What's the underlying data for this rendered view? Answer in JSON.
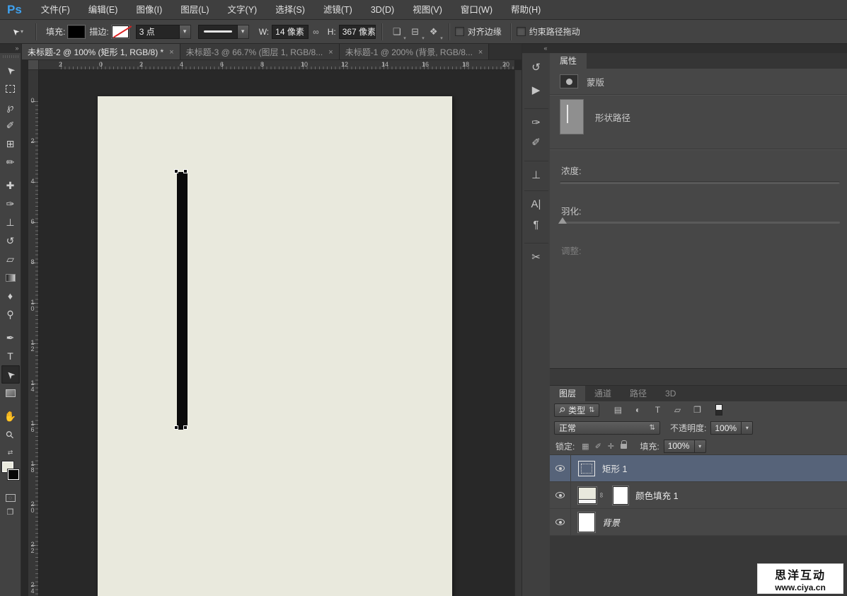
{
  "app": {
    "logo": "Ps",
    "brand_color": "#3fa2f0"
  },
  "menubar": {
    "items": [
      {
        "label": "文件(F)"
      },
      {
        "label": "编辑(E)"
      },
      {
        "label": "图像(I)"
      },
      {
        "label": "图层(L)"
      },
      {
        "label": "文字(Y)"
      },
      {
        "label": "选择(S)"
      },
      {
        "label": "滤镜(T)"
      },
      {
        "label": "3D(D)"
      },
      {
        "label": "视图(V)"
      },
      {
        "label": "窗口(W)"
      },
      {
        "label": "帮助(H)"
      }
    ]
  },
  "options_bar": {
    "tool_cursor_glyph": "➤",
    "dropdown_glyph": "▾",
    "fill_label": "填充:",
    "stroke_label": "描边:",
    "stroke_width_value": "3 点",
    "w_label": "W:",
    "w_value": "14 像素",
    "link_glyph": "∞",
    "h_label": "H:",
    "h_value": "367 像素",
    "path_ops_glyph": "❏",
    "path_align_glyph": "⊟",
    "path_arrange_glyph": "❖",
    "align_edges_label": "对齐边缘",
    "constrain_path_label": "约束路径拖动"
  },
  "tabs": [
    {
      "title": "未标题-2 @ 100% (矩形 1, RGB/8) *",
      "close": "×",
      "active": true
    },
    {
      "title": "未标题-3 @ 66.7% (图层 1, RGB/8...",
      "close": "×"
    },
    {
      "title": "未标题-1 @ 200% (背景, RGB/8...",
      "close": "×"
    }
  ],
  "toolbar": {
    "collapse_glyph": "»",
    "tools": [
      {
        "name": "move-tool",
        "glyph": "➤",
        "cls": "rot-cursor"
      },
      {
        "name": "rectangular-marquee-tool",
        "glyph": "",
        "box": "box-dashed"
      },
      {
        "name": "lasso-tool",
        "glyph": "℘"
      },
      {
        "name": "quick-selection-tool",
        "glyph": "✐"
      },
      {
        "name": "crop-tool",
        "glyph": "⊞"
      },
      {
        "name": "eyedropper-tool",
        "glyph": "✏"
      },
      {
        "name": "spot-healing-brush-tool",
        "glyph": "✚",
        "gap": true
      },
      {
        "name": "brush-tool",
        "glyph": "✑"
      },
      {
        "name": "clone-stamp-tool",
        "glyph": "⊥"
      },
      {
        "name": "history-brush-tool",
        "glyph": "↺"
      },
      {
        "name": "eraser-tool",
        "glyph": "▱"
      },
      {
        "name": "gradient-tool",
        "glyph": "",
        "box": "box-grad"
      },
      {
        "name": "blur-tool",
        "glyph": "♦"
      },
      {
        "name": "dodge-tool",
        "glyph": "⚲"
      },
      {
        "name": "pen-tool",
        "glyph": "✒",
        "gap": true
      },
      {
        "name": "type-tool",
        "glyph": "T"
      },
      {
        "name": "direct-selection-tool",
        "glyph": "➤",
        "cls": "rot-cursor",
        "selected": true
      },
      {
        "name": "rectangle-tool",
        "glyph": "",
        "box": "box-fill"
      },
      {
        "name": "hand-tool",
        "glyph": "✋",
        "gap": true
      },
      {
        "name": "zoom-tool",
        "glyph": "⚲",
        "cls": "rot45"
      }
    ],
    "swap_colors_glyph": "⇄",
    "quick_mask_glyph": "◌",
    "screen_mode_glyph": "❐"
  },
  "rulers": {
    "h_numbers": [
      "2",
      "0",
      "2",
      "4",
      "6",
      "8",
      "10",
      "12",
      "14",
      "16",
      "18",
      "20"
    ],
    "v_numbers": [
      "0",
      "2",
      "4",
      "6",
      "8",
      "10",
      "12",
      "14",
      "16",
      "18",
      "20",
      "22",
      "24"
    ]
  },
  "canvas": {
    "doc_color": "#e9e9dd",
    "shape_color": "#0b0b0b",
    "workarea_color": "#282828"
  },
  "dock": {
    "collapse_glyph": "«",
    "icons": [
      {
        "name": "history-panel-icon",
        "glyph": "↺"
      },
      {
        "name": "actions-panel-icon",
        "glyph": "▶"
      },
      {
        "name": "brush-panel-icon",
        "glyph": "✑",
        "gap": true
      },
      {
        "name": "brush-presets-panel-icon",
        "glyph": "✐"
      },
      {
        "name": "clone-source-panel-icon",
        "glyph": "⊥",
        "gap": true
      },
      {
        "name": "character-panel-icon",
        "glyph": "A|",
        "gap": true
      },
      {
        "name": "paragraph-panel-icon",
        "glyph": "¶"
      },
      {
        "name": "tool-presets-panel-icon",
        "glyph": "✂",
        "gap": true
      }
    ]
  },
  "properties": {
    "tab": "属性",
    "mask_label": "蒙版",
    "shape_label": "形状路径",
    "density_label": "浓度:",
    "feather_label": "羽化:",
    "adjust_label": "调整:"
  },
  "layers_panel": {
    "tabs": [
      {
        "label": "图层",
        "active": true
      },
      {
        "label": "通道"
      },
      {
        "label": "路径"
      },
      {
        "label": "3D"
      }
    ],
    "search_glyph": "⚲",
    "filter_label": "类型",
    "updown_glyph": "⇅",
    "filter_icons": [
      {
        "name": "filter-pixel-layers-icon",
        "glyph": "▤"
      },
      {
        "name": "filter-adjustment-layers-icon",
        "glyph": "◐"
      },
      {
        "name": "filter-type-layers-icon",
        "glyph": "T"
      },
      {
        "name": "filter-shape-layers-icon",
        "glyph": "▱"
      },
      {
        "name": "filter-smart-objects-icon",
        "glyph": "❐"
      }
    ],
    "blend_mode": "正常",
    "opacity_label": "不透明度:",
    "opacity_value": "100%",
    "lock_label": "锁定:",
    "lock_icons": [
      {
        "name": "lock-transparency-icon",
        "glyph": "▦"
      },
      {
        "name": "lock-pixels-icon",
        "glyph": "✐"
      },
      {
        "name": "lock-position-icon",
        "glyph": "✛"
      },
      {
        "name": "lock-all-icon",
        "glyph": "",
        "box": "padlock"
      }
    ],
    "fill_label": "填充:",
    "fill_value": "100%",
    "link_glyph": "∞",
    "dropdown_glyph": "▾",
    "layers": [
      {
        "name": "矩形 1",
        "type": "shape",
        "selected": true
      },
      {
        "name": "颜色填充 1",
        "type": "fill"
      },
      {
        "name": "背景",
        "type": "background"
      }
    ]
  },
  "watermark": {
    "line1": "思洋互动",
    "line2": "www.ciya.cn"
  },
  "colors": {
    "selected_layer_row": "#566379",
    "panel_bg": "#474747",
    "workarea_bg": "#282828",
    "document_bg": "#e9e9dd",
    "menubar_bg": "#3f3f3f",
    "accent_blue": "#3fa2f0"
  }
}
